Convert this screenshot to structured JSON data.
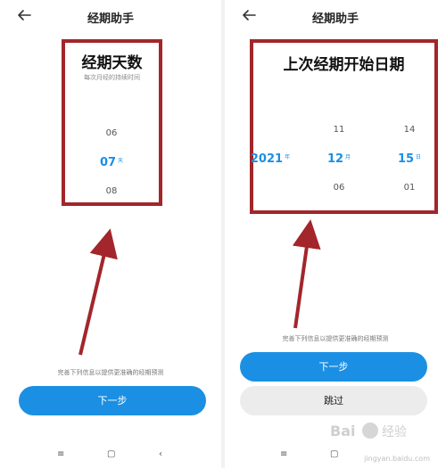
{
  "left": {
    "header_title": "经期助手",
    "picker_title": "经期天数",
    "picker_subtitle": "每次月经的持续时间",
    "values": {
      "prev": "06",
      "selected": "07",
      "selected_unit": "天",
      "next": "08"
    },
    "hint": "完善下列信息以提供更准确的经期预测",
    "next_button": "下一步"
  },
  "right": {
    "header_title": "经期助手",
    "picker_title": "上次经期开始日期",
    "year_selected": "2021",
    "year_unit": "年",
    "month": {
      "prev": "11",
      "selected": "12",
      "unit": "月",
      "next": "06"
    },
    "day": {
      "prev": "14",
      "selected": "15",
      "unit": "日",
      "next": "01"
    },
    "hint": "完善下列信息以提供更准确的经期预测",
    "next_button": "下一步",
    "skip_button": "跳过"
  },
  "watermark": {
    "text": "jingyan.baidu.com"
  },
  "colors": {
    "accent": "#1b8fe3",
    "highlight": "#a2262b",
    "arrow": "#a2262b"
  },
  "icons": {
    "back": "back-arrow-icon",
    "nav_menu": "menu-icon",
    "nav_home": "home-icon",
    "nav_back": "back-icon"
  }
}
